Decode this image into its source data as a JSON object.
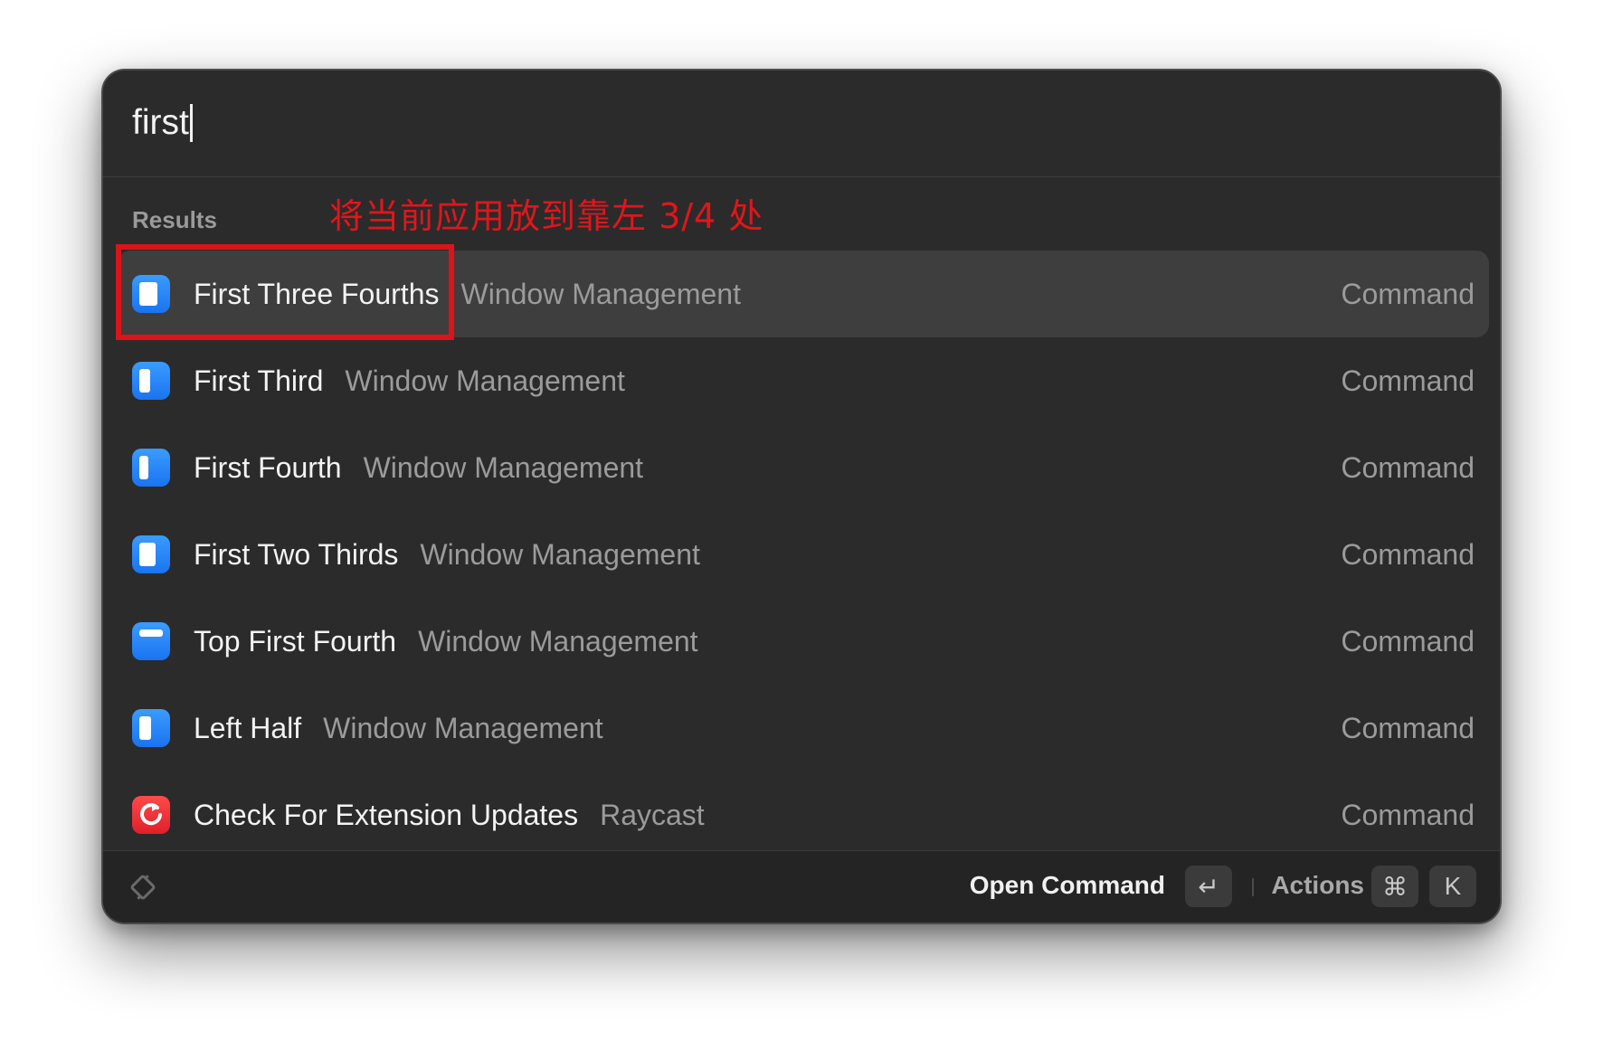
{
  "search": {
    "query": "first"
  },
  "section": {
    "label": "Results"
  },
  "annotation": {
    "text": "将当前应用放到靠左 3/4 处",
    "color": "#e0161b"
  },
  "results": [
    {
      "title": "First Three Fourths",
      "subtitle": "Window Management",
      "type": "Command",
      "icon": "window-three-fourths-icon",
      "selected": true
    },
    {
      "title": "First Third",
      "subtitle": "Window Management",
      "type": "Command",
      "icon": "window-first-third-icon",
      "selected": false
    },
    {
      "title": "First Fourth",
      "subtitle": "Window Management",
      "type": "Command",
      "icon": "window-first-fourth-icon",
      "selected": false
    },
    {
      "title": "First Two Thirds",
      "subtitle": "Window Management",
      "type": "Command",
      "icon": "window-two-thirds-icon",
      "selected": false
    },
    {
      "title": "Top First Fourth",
      "subtitle": "Window Management",
      "type": "Command",
      "icon": "window-top-fourth-icon",
      "selected": false
    },
    {
      "title": "Left Half",
      "subtitle": "Window Management",
      "type": "Command",
      "icon": "window-left-half-icon",
      "selected": false
    },
    {
      "title": "Check For Extension Updates",
      "subtitle": "Raycast",
      "type": "Command",
      "icon": "raycast-refresh-icon",
      "selected": false
    }
  ],
  "footer": {
    "primary_action": "Open Command",
    "enter_key": "↵",
    "actions_label": "Actions",
    "cmd_key": "⌘",
    "k_key": "K"
  },
  "colors": {
    "accent_blue": "#1a74f0",
    "raycast_red": "#e0202a",
    "highlight_box": "#d9141b",
    "panel_bg": "#2b2b2b"
  }
}
